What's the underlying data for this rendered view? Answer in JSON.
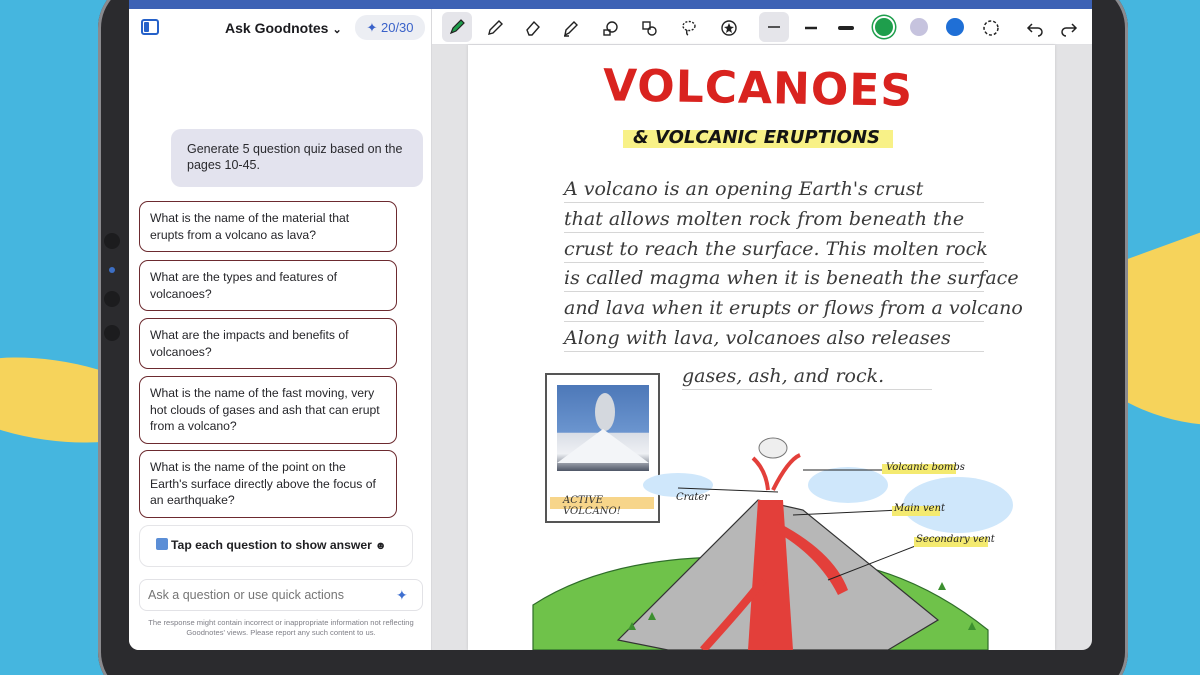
{
  "panel": {
    "title": "Ask Goodnotes",
    "credits": "20/30",
    "prompt": "Generate 5 question quiz based on the pages 10-45.",
    "questions": [
      "What is the name of the material that erupts from a volcano as lava?",
      "What are the types and features of volcanoes?",
      "What are the impacts and benefits of volcanoes?",
      "What is the name of the fast moving, very hot clouds of gases and ash that can erupt from a volcano?",
      "What is the name of the point on the Earth's surface directly above the focus of an earthquake?"
    ],
    "hint": "Tap each question to show answer",
    "input_placeholder": "Ask a question or use quick actions",
    "disclaimer": "The response might contain incorrect or inappropriate information not reflecting Goodnotes' views. Please report any such content to us."
  },
  "toolbar": {
    "tools": [
      "pen-icon",
      "pencil-icon",
      "eraser-icon",
      "highlighter-icon",
      "shapes-icon",
      "elements-icon",
      "lasso-icon",
      "stickers-icon"
    ],
    "colors": [
      "#1e9e4c",
      "#c6c3de",
      "#1f6fd6"
    ],
    "active_color": "#1e9e4c"
  },
  "document": {
    "title": "VOLCANOES",
    "subtitle": "& VOLCANIC ERUPTIONS",
    "lines": [
      "A volcano is an opening Earth's crust",
      "that allows molten rock from beneath the",
      "crust to reach the surface. This molten rock",
      "is called magma when it is beneath the surface",
      "and lava when it erupts or flows from a volcano",
      "Along with lava, volcanoes also releases",
      "gases, ash, and rock."
    ],
    "photo_label": "ACTIVE VOLCANO!",
    "annotations": {
      "crater": "Crater",
      "bombs": "Volcanic bombs",
      "main_vent": "Main vent",
      "secondary_vent": "Secondary vent"
    }
  }
}
